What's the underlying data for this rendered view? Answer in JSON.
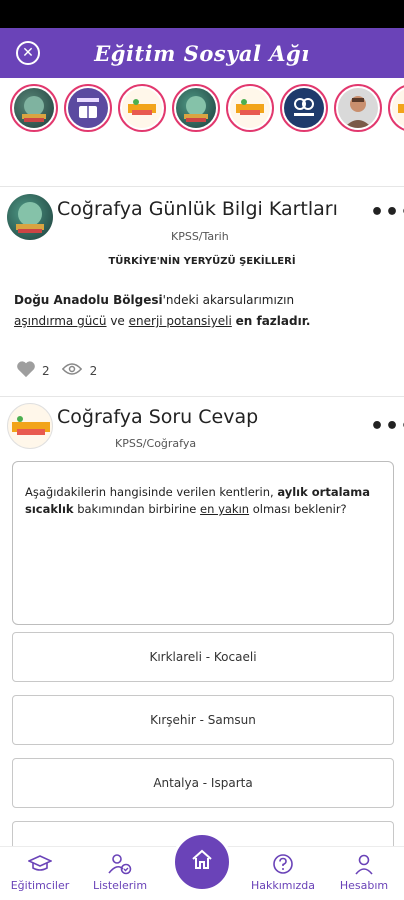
{
  "app": {
    "title": "Eğitim Sosyal Ağı",
    "close_icon": "close-circle-icon",
    "primary_color": "#6a43b8",
    "story_ring_color": "#e2386e"
  },
  "stories": [
    {
      "name": "story-1",
      "icon": "globe-books-icon"
    },
    {
      "name": "story-2",
      "icon": "book-badge-icon"
    },
    {
      "name": "story-3",
      "icon": "banner-logo-icon"
    },
    {
      "name": "story-4",
      "icon": "globe-books-icon"
    },
    {
      "name": "story-5",
      "icon": "banner-logo-icon"
    },
    {
      "name": "story-6",
      "icon": "kpss-logo-icon"
    },
    {
      "name": "story-7",
      "icon": "person-photo-icon"
    },
    {
      "name": "story-8",
      "icon": "banner-logo-icon"
    }
  ],
  "posts": [
    {
      "title": "Coğrafya Günlük  Bilgi Kartları",
      "category": "KPSS/Tarih",
      "heading": "TÜRKİYE'NİN YERYÜZÜ ŞEKİLLERİ",
      "body_bold_1": "Doğu Anadolu Bölgesi",
      "body_text_1": "'ndeki akarsularımızın",
      "body_underline_1": "aşındırma gücü",
      "body_text_2": " ve ",
      "body_underline_2": "enerji potansiyeli",
      "body_text_3": " ",
      "body_bold_2": "en fazladır.",
      "likes": "2",
      "views": "2"
    },
    {
      "title": "Coğrafya Soru Cevap",
      "category": "KPSS/Coğrafya",
      "question_1": "Aşağıdakilerin hangisinde verilen kentlerin, ",
      "question_bold": "aylık ortalama sıcaklık",
      "question_2": " bakımından birbirine ",
      "question_underline": "en yakın",
      "question_3": " olması beklenir?",
      "options": [
        "Kırklareli - Kocaeli",
        "Kırşehir - Samsun",
        "Antalya - Isparta"
      ]
    }
  ],
  "bottom_nav": {
    "items": [
      {
        "label": "Eğitimciler",
        "icon": "graduation-cap-icon"
      },
      {
        "label": "Listelerim",
        "icon": "users-check-icon"
      },
      {
        "label": "Hakkımızda",
        "icon": "question-circle-icon"
      },
      {
        "label": "Hesabım",
        "icon": "person-icon"
      }
    ],
    "home_icon": "home-icon"
  }
}
